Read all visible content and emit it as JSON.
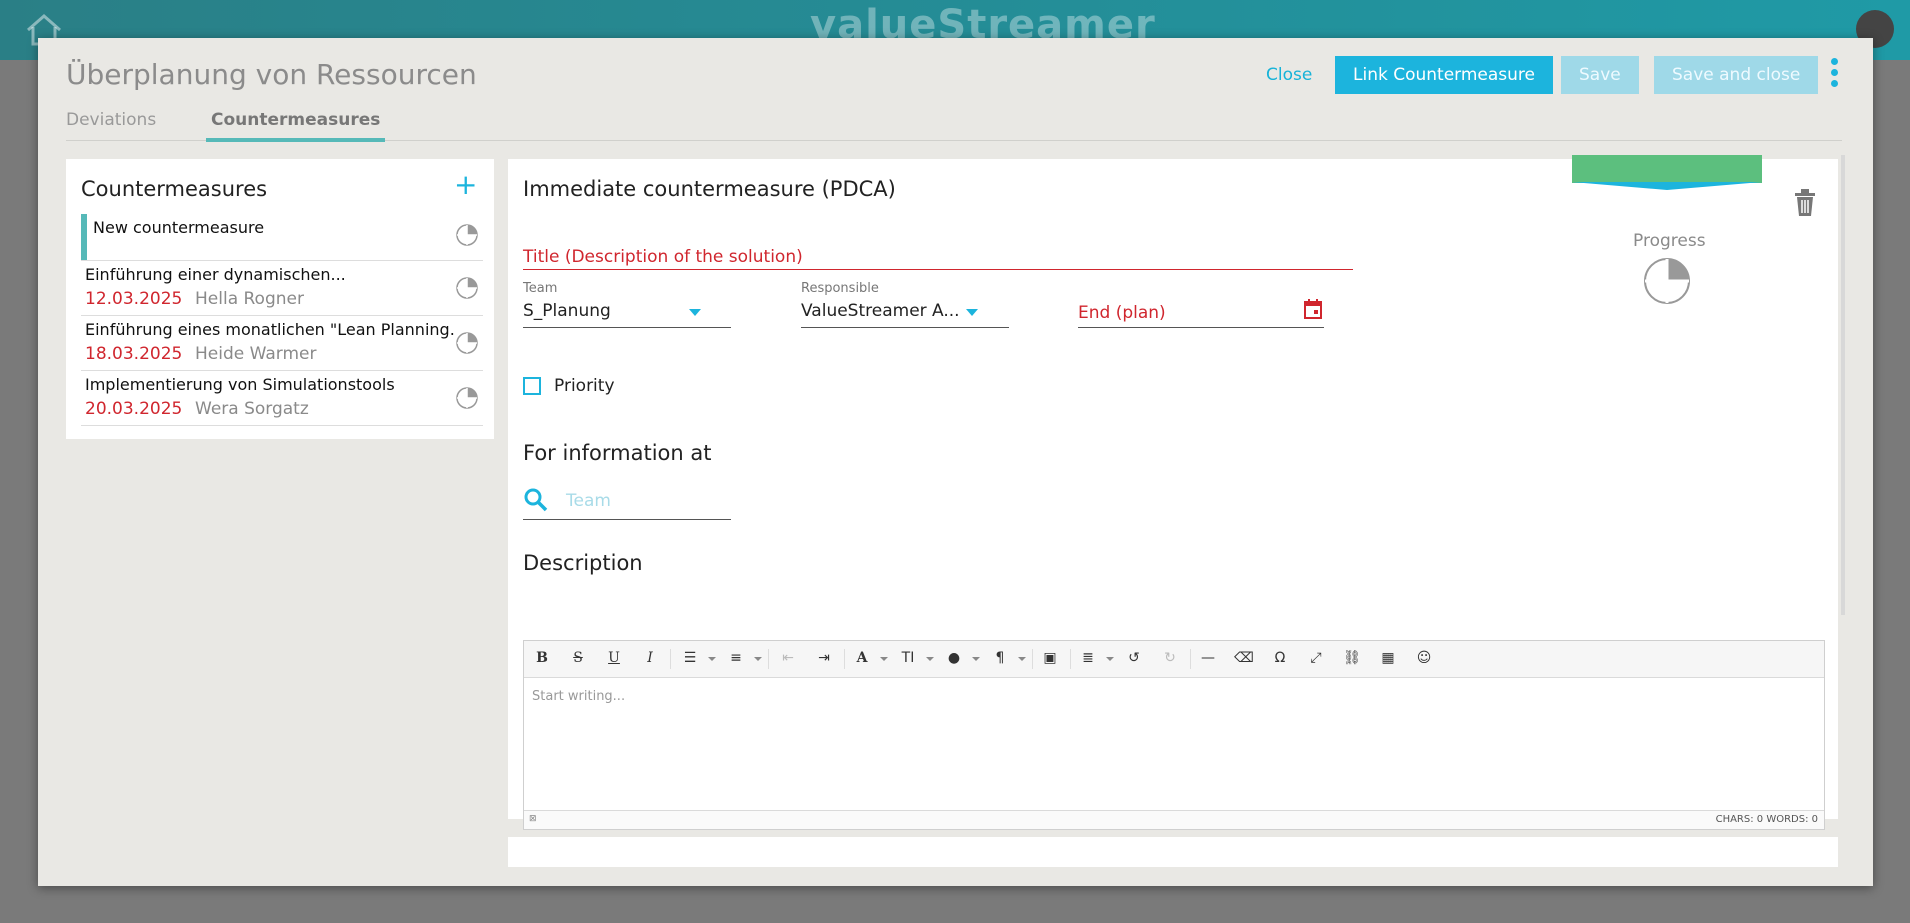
{
  "app": {
    "brand": "valueStreamer"
  },
  "modal": {
    "title": "Überplanung von Ressourcen",
    "tabs": [
      {
        "label": "Deviations"
      },
      {
        "label": "Countermeasures"
      }
    ],
    "actions": {
      "close": "Close",
      "link_countermeasure": "Link Countermeasure",
      "save": "Save",
      "save_and_close": "Save and close"
    }
  },
  "left_panel": {
    "title": "Countermeasures",
    "items": [
      {
        "name": "New countermeasure",
        "date": "",
        "person": ""
      },
      {
        "name": "Einführung einer dynamischen...",
        "date": "12.03.2025",
        "person": "Hella Rogner"
      },
      {
        "name": "Einführung eines monatlichen \"Lean Planning...",
        "date": "18.03.2025",
        "person": "Heide Warmer"
      },
      {
        "name": "Implementierung von Simulationstools",
        "date": "20.03.2025",
        "person": "Wera Sorgatz"
      }
    ]
  },
  "form": {
    "heading": "Immediate countermeasure (PDCA)",
    "title_placeholder": "Title (Description of the solution)",
    "team_label": "Team",
    "team_value": "S_Planung",
    "responsible_label": "Responsible",
    "responsible_value": "ValueStreamer A...",
    "end_plan_label": "End (plan)",
    "priority_label": "Priority",
    "progress_label": "Progress",
    "info_heading": "For information at",
    "info_team_placeholder": "Team",
    "description_heading": "Description",
    "editor_placeholder": "Start writing...",
    "editor_counts": "CHARS: 0   WORDS: 0"
  },
  "colors": {
    "accent": "#1cb4dd",
    "teal": "#56b9b8",
    "danger": "#d0262e",
    "status_green": "#5cbf7e"
  }
}
